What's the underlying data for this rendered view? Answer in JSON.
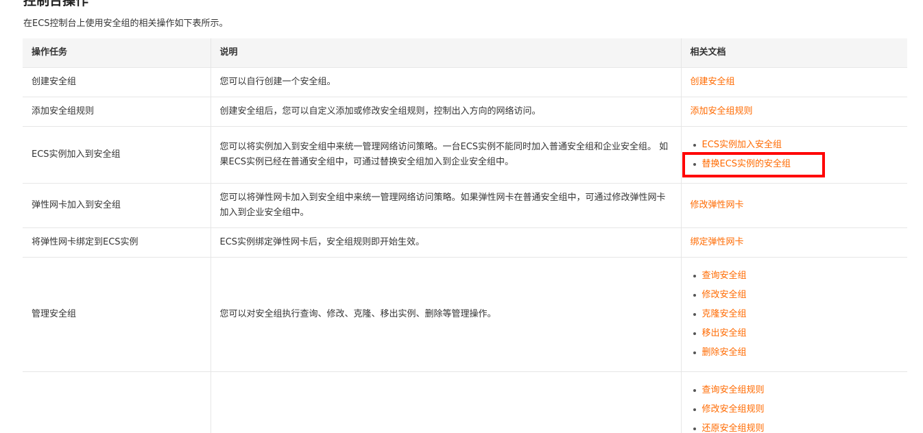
{
  "section": {
    "title": "控制台操作",
    "intro": "在ECS控制台上使用安全组的相关操作如下表所示。"
  },
  "table": {
    "headers": [
      "操作任务",
      "说明",
      "相关文档"
    ],
    "rows": [
      {
        "task": "创建安全组",
        "desc": "您可以自行创建一个安全组。",
        "links": [
          "创建安全组"
        ]
      },
      {
        "task": "添加安全组规则",
        "desc": "创建安全组后，您可以自定义添加或修改安全组规则，控制出入方向的网络访问。",
        "links": [
          "添加安全组规则"
        ]
      },
      {
        "task": "ECS实例加入到安全组",
        "desc": "您可以将实例加入到安全组中来统一管理网络访问策略。一台ECS实例不能同时加入普通安全组和企业安全组。 如果ECS实例已经在普通安全组中，可通过替换安全组加入到企业安全组中。",
        "links": [
          "ECS实例加入安全组",
          "替换ECS实例的安全组"
        ]
      },
      {
        "task": "弹性网卡加入到安全组",
        "desc": "您可以将弹性网卡加入到安全组中来统一管理网络访问策略。如果弹性网卡在普通安全组中，可通过修改弹性网卡加入到企业安全组中。",
        "links": [
          "修改弹性网卡"
        ]
      },
      {
        "task": "将弹性网卡绑定到ECS实例",
        "desc": "ECS实例绑定弹性网卡后，安全组规则即开始生效。",
        "links": [
          "绑定弹性网卡"
        ]
      },
      {
        "task": "管理安全组",
        "desc": "您可以对安全组执行查询、修改、克隆、移出实例、删除等管理操作。",
        "links": [
          "查询安全组",
          "修改安全组",
          "克隆安全组",
          "移出安全组",
          "删除安全组"
        ]
      },
      {
        "task": "",
        "desc": "",
        "links": [
          "查询安全组规则",
          "修改安全组规则",
          "还原安全组规则"
        ]
      }
    ]
  },
  "colors": {
    "link": "#ff6a00",
    "header_bg": "#f5f5f5",
    "border": "#e6e6e6",
    "highlight": "#ff0000"
  }
}
